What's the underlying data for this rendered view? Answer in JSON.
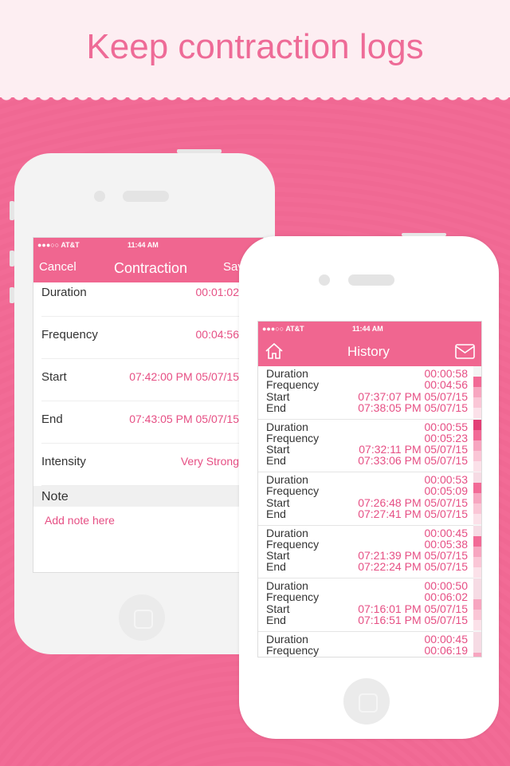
{
  "banner": {
    "title": "Keep contraction logs"
  },
  "status": {
    "carrier": "●●●○○ AT&T",
    "time": "11:44 AM"
  },
  "contraction_screen": {
    "cancel": "Cancel",
    "title": "Contraction",
    "save": "Save",
    "rows": [
      {
        "label": "Duration",
        "value": "00:01:02"
      },
      {
        "label": "Frequency",
        "value": "00:04:56"
      },
      {
        "label": "Start",
        "value": "07:42:00 PM 05/07/15"
      },
      {
        "label": "End",
        "value": "07:43:05 PM 05/07/15"
      },
      {
        "label": "Intensity",
        "value": "Very Strong"
      }
    ],
    "note_header": "Note",
    "note_placeholder": "Add note here"
  },
  "history_screen": {
    "title": "History",
    "labels": [
      "Duration",
      "Frequency",
      "Start",
      "End"
    ],
    "entries": [
      {
        "duration": "00:00:58",
        "frequency": "00:04:56",
        "start": "07:37:07 PM 05/07/15",
        "end": "07:38:05 PM 05/07/15",
        "intensity": 0.6
      },
      {
        "duration": "00:00:55",
        "frequency": "00:05:23",
        "start": "07:32:11 PM 05/07/15",
        "end": "07:33:06 PM 05/07/15",
        "intensity": 1.0
      },
      {
        "duration": "00:00:53",
        "frequency": "00:05:09",
        "start": "07:26:48 PM 05/07/15",
        "end": "07:27:41 PM 05/07/15",
        "intensity": 0.6
      },
      {
        "duration": "00:00:45",
        "frequency": "00:05:38",
        "start": "07:21:39 PM 05/07/15",
        "end": "07:22:24 PM 05/07/15",
        "intensity": 0.6
      },
      {
        "duration": "00:00:50",
        "frequency": "00:06:02",
        "start": "07:16:01 PM 05/07/15",
        "end": "07:16:51 PM 05/07/15",
        "intensity": 0.2
      },
      {
        "duration": "00:00:45",
        "frequency": "00:06:19",
        "start": "",
        "end": "",
        "intensity": 0.2
      }
    ]
  },
  "colors": {
    "accent": "#f06690",
    "value_text": "#e64f84",
    "banner_bg": "#fdeef2"
  }
}
